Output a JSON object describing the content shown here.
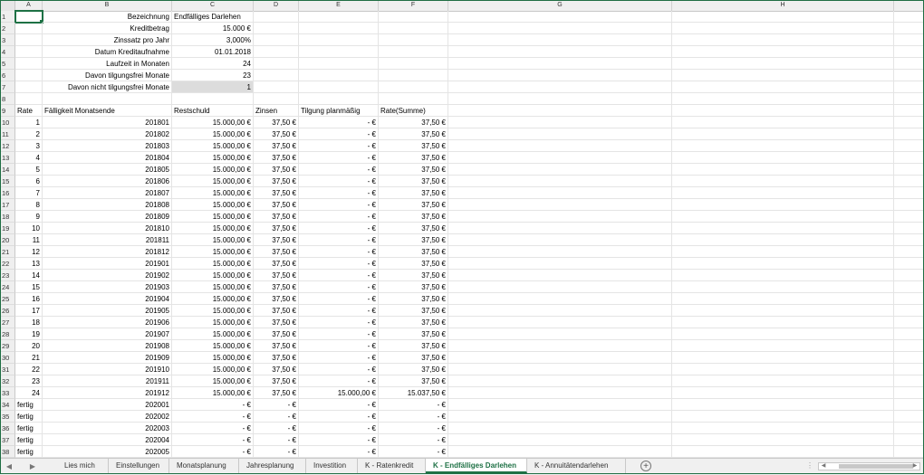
{
  "columns": [
    "A",
    "B",
    "C",
    "D",
    "E",
    "F",
    "G",
    "H"
  ],
  "top_block": [
    {
      "row": 1,
      "label": "Bezeichnung",
      "value": "Endfälliges Darlehen",
      "value_align": "left"
    },
    {
      "row": 2,
      "label": "Kreditbetrag",
      "value": "15.000 €",
      "value_align": "right"
    },
    {
      "row": 3,
      "label": "Zinssatz pro Jahr",
      "value": "3,000%",
      "value_align": "right"
    },
    {
      "row": 4,
      "label": "Datum Kreditaufnahme",
      "value": "01.01.2018",
      "value_align": "right"
    },
    {
      "row": 5,
      "label": "Laufzeit in Monaten",
      "value": "24",
      "value_align": "right"
    },
    {
      "row": 6,
      "label": "Davon tilgungsfrei Monate",
      "value": "23",
      "value_align": "right"
    },
    {
      "row": 7,
      "label": "Davon nicht tilgungsfrei Monate",
      "value": "1",
      "value_align": "right"
    }
  ],
  "table_header": {
    "row": 9,
    "a": "Rate",
    "b": "Fälligkeit Monatsende",
    "c": "Restschuld",
    "d": "Zinsen",
    "e": "Tilgung planmäßig",
    "f": "Rate(Summe)"
  },
  "table_rows": [
    {
      "row": 10,
      "a": "1",
      "b": "201801",
      "c": "15.000,00 €",
      "d": "37,50 €",
      "e": "-   €",
      "f": "37,50 €"
    },
    {
      "row": 11,
      "a": "2",
      "b": "201802",
      "c": "15.000,00 €",
      "d": "37,50 €",
      "e": "-   €",
      "f": "37,50 €"
    },
    {
      "row": 12,
      "a": "3",
      "b": "201803",
      "c": "15.000,00 €",
      "d": "37,50 €",
      "e": "-   €",
      "f": "37,50 €"
    },
    {
      "row": 13,
      "a": "4",
      "b": "201804",
      "c": "15.000,00 €",
      "d": "37,50 €",
      "e": "-   €",
      "f": "37,50 €"
    },
    {
      "row": 14,
      "a": "5",
      "b": "201805",
      "c": "15.000,00 €",
      "d": "37,50 €",
      "e": "-   €",
      "f": "37,50 €"
    },
    {
      "row": 15,
      "a": "6",
      "b": "201806",
      "c": "15.000,00 €",
      "d": "37,50 €",
      "e": "-   €",
      "f": "37,50 €"
    },
    {
      "row": 16,
      "a": "7",
      "b": "201807",
      "c": "15.000,00 €",
      "d": "37,50 €",
      "e": "-   €",
      "f": "37,50 €"
    },
    {
      "row": 17,
      "a": "8",
      "b": "201808",
      "c": "15.000,00 €",
      "d": "37,50 €",
      "e": "-   €",
      "f": "37,50 €"
    },
    {
      "row": 18,
      "a": "9",
      "b": "201809",
      "c": "15.000,00 €",
      "d": "37,50 €",
      "e": "-   €",
      "f": "37,50 €"
    },
    {
      "row": 19,
      "a": "10",
      "b": "201810",
      "c": "15.000,00 €",
      "d": "37,50 €",
      "e": "-   €",
      "f": "37,50 €"
    },
    {
      "row": 20,
      "a": "11",
      "b": "201811",
      "c": "15.000,00 €",
      "d": "37,50 €",
      "e": "-   €",
      "f": "37,50 €"
    },
    {
      "row": 21,
      "a": "12",
      "b": "201812",
      "c": "15.000,00 €",
      "d": "37,50 €",
      "e": "-   €",
      "f": "37,50 €"
    },
    {
      "row": 22,
      "a": "13",
      "b": "201901",
      "c": "15.000,00 €",
      "d": "37,50 €",
      "e": "-   €",
      "f": "37,50 €"
    },
    {
      "row": 23,
      "a": "14",
      "b": "201902",
      "c": "15.000,00 €",
      "d": "37,50 €",
      "e": "-   €",
      "f": "37,50 €"
    },
    {
      "row": 24,
      "a": "15",
      "b": "201903",
      "c": "15.000,00 €",
      "d": "37,50 €",
      "e": "-   €",
      "f": "37,50 €"
    },
    {
      "row": 25,
      "a": "16",
      "b": "201904",
      "c": "15.000,00 €",
      "d": "37,50 €",
      "e": "-   €",
      "f": "37,50 €"
    },
    {
      "row": 26,
      "a": "17",
      "b": "201905",
      "c": "15.000,00 €",
      "d": "37,50 €",
      "e": "-   €",
      "f": "37,50 €"
    },
    {
      "row": 27,
      "a": "18",
      "b": "201906",
      "c": "15.000,00 €",
      "d": "37,50 €",
      "e": "-   €",
      "f": "37,50 €"
    },
    {
      "row": 28,
      "a": "19",
      "b": "201907",
      "c": "15.000,00 €",
      "d": "37,50 €",
      "e": "-   €",
      "f": "37,50 €"
    },
    {
      "row": 29,
      "a": "20",
      "b": "201908",
      "c": "15.000,00 €",
      "d": "37,50 €",
      "e": "-   €",
      "f": "37,50 €"
    },
    {
      "row": 30,
      "a": "21",
      "b": "201909",
      "c": "15.000,00 €",
      "d": "37,50 €",
      "e": "-   €",
      "f": "37,50 €"
    },
    {
      "row": 31,
      "a": "22",
      "b": "201910",
      "c": "15.000,00 €",
      "d": "37,50 €",
      "e": "-   €",
      "f": "37,50 €"
    },
    {
      "row": 32,
      "a": "23",
      "b": "201911",
      "c": "15.000,00 €",
      "d": "37,50 €",
      "e": "-   €",
      "f": "37,50 €"
    },
    {
      "row": 33,
      "a": "24",
      "b": "201912",
      "c": "15.000,00 €",
      "d": "37,50 €",
      "e": "15.000,00 €",
      "f": "15.037,50 €"
    },
    {
      "row": 34,
      "a": "fertig",
      "b": "202001",
      "c": "-   €",
      "d": "-   €",
      "e": "-   €",
      "f": "-   €"
    },
    {
      "row": 35,
      "a": "fertig",
      "b": "202002",
      "c": "-   €",
      "d": "-   €",
      "e": "-   €",
      "f": "-   €"
    },
    {
      "row": 36,
      "a": "fertig",
      "b": "202003",
      "c": "-   €",
      "d": "-   €",
      "e": "-   €",
      "f": "-   €"
    },
    {
      "row": 37,
      "a": "fertig",
      "b": "202004",
      "c": "-   €",
      "d": "-   €",
      "e": "-   €",
      "f": "-   €"
    },
    {
      "row": 38,
      "a": "fertig",
      "b": "202005",
      "c": "-   €",
      "d": "-   €",
      "e": "-   €",
      "f": "-   €"
    }
  ],
  "sheet_tabs": [
    {
      "label": "Lies mich",
      "active": false
    },
    {
      "label": "Einstellungen",
      "active": false
    },
    {
      "label": "Monatsplanung",
      "active": false
    },
    {
      "label": "Jahresplanung",
      "active": false
    },
    {
      "label": "Investition",
      "active": false
    },
    {
      "label": "K - Ratenkredit",
      "active": false
    },
    {
      "label": "K - Endfälliges Darlehen",
      "active": true
    },
    {
      "label": "K - Annuitätendarlehen",
      "active": false
    }
  ],
  "nav": {
    "prev": "◀",
    "next": "▶",
    "add": "+",
    "dots": "⋮"
  },
  "accent_color": "#1e7145"
}
